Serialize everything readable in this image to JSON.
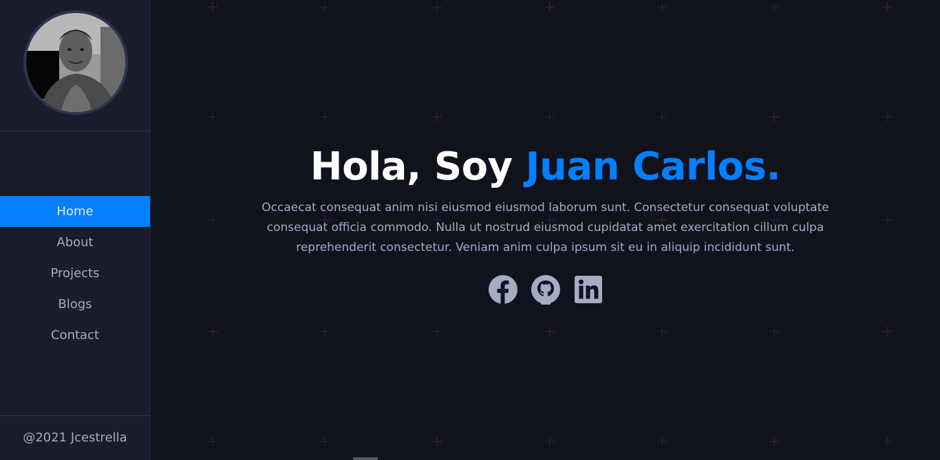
{
  "sidebar": {
    "avatar_alt": "Profile photo",
    "nav": [
      {
        "label": "Home",
        "active": true
      },
      {
        "label": "About",
        "active": false
      },
      {
        "label": "Projects",
        "active": false
      },
      {
        "label": "Blogs",
        "active": false
      },
      {
        "label": "Contact",
        "active": false
      }
    ],
    "footer": "@2021 Jcestrella"
  },
  "hero": {
    "greeting": "Hola, Soy ",
    "name": "Juan Carlos.",
    "description": "Occaecat consequat anim nisi eiusmod eiusmod laborum sunt. Consectetur consequat voluptate consequat officia commodo. Nulla ut nostrud eiusmod cupidatat amet exercitation cillum culpa reprehenderit consectetur. Veniam anim culpa ipsum sit eu in aliquip incididunt sunt."
  },
  "socials": [
    {
      "icon": "facebook-icon"
    },
    {
      "icon": "github-icon"
    },
    {
      "icon": "linkedin-icon"
    }
  ],
  "colors": {
    "accent": "#037fff",
    "sidebar_bg": "#191d2b",
    "main_bg": "#10121c",
    "text_muted": "#a4acc4"
  }
}
